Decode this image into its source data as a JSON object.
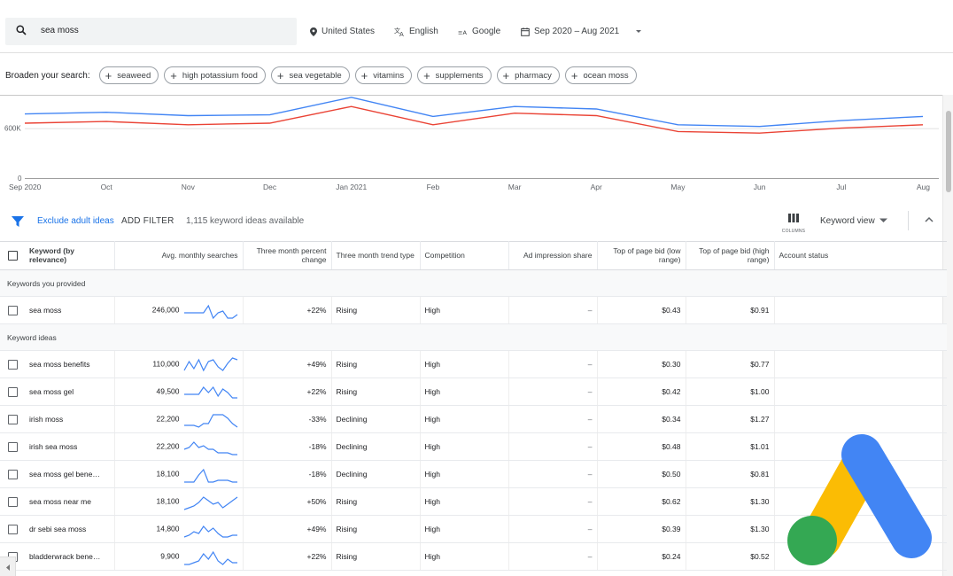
{
  "search": {
    "query": "sea moss"
  },
  "filters": {
    "location": "United States",
    "language": "English",
    "network": "Google",
    "date_range": "Sep 2020 – Aug 2021"
  },
  "broaden": {
    "label": "Broaden your search:",
    "pills": [
      "seaweed",
      "high potassium food",
      "sea vegetable",
      "vitamins",
      "supplements",
      "pharmacy",
      "ocean moss"
    ]
  },
  "chart_data": {
    "type": "line",
    "x": [
      "Sep 2020",
      "Oct",
      "Nov",
      "Dec",
      "Jan 2021",
      "Feb",
      "Mar",
      "Apr",
      "May",
      "Jun",
      "Jul",
      "Aug"
    ],
    "y_ticks": [
      "600K",
      "0"
    ],
    "series": [
      {
        "color": "#4285f4",
        "values": [
          770000,
          790000,
          750000,
          760000,
          970000,
          740000,
          860000,
          830000,
          640000,
          620000,
          690000,
          740000
        ]
      },
      {
        "color": "#ea4335",
        "values": [
          660000,
          680000,
          640000,
          660000,
          860000,
          640000,
          780000,
          750000,
          560000,
          540000,
          600000,
          640000
        ]
      }
    ]
  },
  "toolbar": {
    "exclude": "Exclude adult ideas",
    "add_filter": "ADD FILTER",
    "available": "1,115 keyword ideas available",
    "columns": "COLUMNS",
    "view": "Keyword view"
  },
  "table": {
    "headers": [
      "Keyword (by relevance)",
      "Avg. monthly searches",
      "Three month percent change",
      "Three month trend type",
      "Competition",
      "Ad impression share",
      "Top of page bid (low range)",
      "Top of page bid (high range)",
      "Account status"
    ],
    "sections": [
      {
        "title": "Keywords you provided",
        "rows": [
          {
            "keyword": "sea moss",
            "searches": "246,000",
            "change": "+22%",
            "trend": "Rising",
            "competition": "High",
            "share": "–",
            "low": "$0.43",
            "high": "$0.91",
            "spark": [
              6,
              6,
              6,
              6,
              6,
              2,
              9,
              6,
              5,
              9,
              9,
              7
            ]
          }
        ]
      },
      {
        "title": "Keyword ideas",
        "rows": [
          {
            "keyword": "sea moss benefits",
            "searches": "110,000",
            "change": "+49%",
            "trend": "Rising",
            "competition": "High",
            "share": "–",
            "low": "$0.30",
            "high": "$0.77",
            "spark": [
              8,
              3,
              7,
              2,
              8,
              3,
              2,
              6,
              8,
              4,
              1,
              2
            ]
          },
          {
            "keyword": "sea moss gel",
            "searches": "49,500",
            "change": "+22%",
            "trend": "Rising",
            "competition": "High",
            "share": "–",
            "low": "$0.42",
            "high": "$1.00",
            "spark": [
              6,
              6,
              6,
              6,
              2,
              5,
              2,
              7,
              3,
              5,
              8,
              8
            ]
          },
          {
            "keyword": "irish moss",
            "searches": "22,200",
            "change": "-33%",
            "trend": "Declining",
            "competition": "High",
            "share": "–",
            "low": "$0.34",
            "high": "$1.27",
            "spark": [
              8,
              8,
              8,
              9,
              7,
              7,
              2,
              2,
              2,
              4,
              7,
              9
            ]
          },
          {
            "keyword": "irish sea moss",
            "searches": "22,200",
            "change": "-18%",
            "trend": "Declining",
            "competition": "High",
            "share": "–",
            "low": "$0.48",
            "high": "$1.01",
            "spark": [
              6,
              5,
              2,
              5,
              4,
              6,
              6,
              8,
              8,
              8,
              9,
              9
            ]
          },
          {
            "keyword": "sea moss gel bene…",
            "searches": "18,100",
            "change": "-18%",
            "trend": "Declining",
            "competition": "High",
            "share": "–",
            "low": "$0.50",
            "high": "$0.81",
            "spark": [
              9,
              9,
              9,
              5,
              2,
              9,
              9,
              8,
              8,
              8,
              9,
              9
            ]
          },
          {
            "keyword": "sea moss near me",
            "searches": "18,100",
            "change": "+50%",
            "trend": "Rising",
            "competition": "High",
            "share": "–",
            "low": "$0.62",
            "high": "$1.30",
            "spark": [
              9,
              8,
              7,
              5,
              2,
              4,
              6,
              5,
              8,
              6,
              4,
              2
            ]
          },
          {
            "keyword": "dr sebi sea moss",
            "searches": "14,800",
            "change": "+49%",
            "trend": "Rising",
            "competition": "High",
            "share": "–",
            "low": "$0.39",
            "high": "$1.30",
            "spark": [
              9,
              8,
              6,
              7,
              3,
              6,
              4,
              7,
              9,
              9,
              8,
              8
            ]
          },
          {
            "keyword": "bladderwrack bene…",
            "searches": "9,900",
            "change": "+22%",
            "trend": "Rising",
            "competition": "High",
            "share": "–",
            "low": "$0.24",
            "high": "$0.52",
            "spark": [
              9,
              9,
              8,
              7,
              3,
              6,
              2,
              7,
              9,
              6,
              8,
              8
            ]
          }
        ]
      }
    ]
  },
  "colors": {
    "accent": "#1a73e8",
    "blue_line": "#4285f4",
    "red_line": "#ea4335",
    "logo_yellow": "#fbbc04",
    "logo_green": "#34a853",
    "logo_blue": "#4285f4"
  }
}
